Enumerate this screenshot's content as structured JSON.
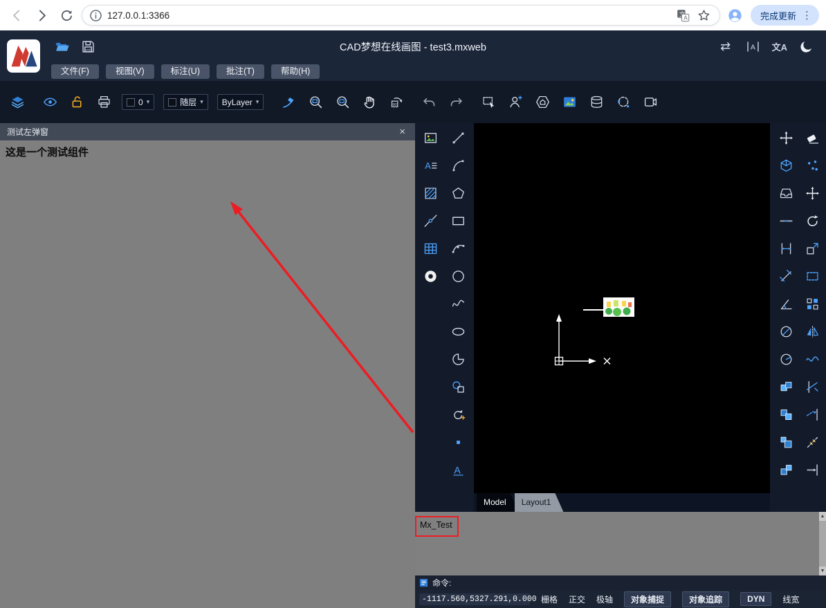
{
  "browser": {
    "url": "127.0.0.1:3366",
    "update_button_label": "完成更新"
  },
  "header": {
    "title": "CAD梦想在线画图 - test3.mxweb",
    "lang_button": "文A",
    "menus": [
      {
        "label": "文件(F)"
      },
      {
        "label": "视图(V)"
      },
      {
        "label": "标注(U)"
      },
      {
        "label": "批注(T)"
      },
      {
        "label": "帮助(H)"
      }
    ]
  },
  "ribbon": {
    "layer_value": "0",
    "color_value": "随层",
    "linetype_value": "ByLayer"
  },
  "left_panel": {
    "title": "测试左弹窗",
    "close_label": "×",
    "content": "这是一个测试组件"
  },
  "draw_tools": {
    "left_column": [
      "insert-image",
      "text-style",
      "hatch",
      "construction-line",
      "table",
      "donut"
    ],
    "right_column": [
      "line",
      "arc",
      "polygon",
      "rectangle",
      "arc-point",
      "circle",
      "spline",
      "ellipse",
      "pie",
      "block",
      "rotate-block",
      "point",
      "text"
    ]
  },
  "edit_tools": {
    "left_column": [
      "move-ucs",
      "box-3d",
      "tray",
      "break",
      "dim-linear",
      "dim-aligned",
      "dim-angular",
      "dim-diameter",
      "dim-radius",
      "copy-a",
      "copy-b",
      "copy-c",
      "copy-d"
    ],
    "right_column": [
      "erase",
      "point-style",
      "move",
      "rotate",
      "scale",
      "stretch",
      "array",
      "mirror",
      "spline-edit",
      "trim",
      "extend",
      "measure",
      "align"
    ]
  },
  "tabs": [
    {
      "label": "Model",
      "active": true
    },
    {
      "label": "Layout1",
      "active": false
    }
  ],
  "command": {
    "history_line": "Mx_Test",
    "prompt": "命令:"
  },
  "status": {
    "coordinates": "-1117.560,5327.291,0.000",
    "toggles": [
      {
        "label": "栅格",
        "active": false
      },
      {
        "label": "正交",
        "active": false
      },
      {
        "label": "极轴",
        "active": false
      },
      {
        "label": "对象捕捉",
        "active": true
      },
      {
        "label": "对象追踪",
        "active": true
      },
      {
        "label": "DYN",
        "active": true
      },
      {
        "label": "线宽",
        "active": false
      }
    ]
  },
  "icons": {
    "kebab": "⋮",
    "caret": "▾",
    "swap": "⇄",
    "scroll_up": "▲",
    "scroll_down": "▼"
  },
  "colors": {
    "accent_blue": "#4da3ff",
    "header_bg": "#1c2639",
    "toolbar_bg": "#111927",
    "panel_gray": "#7f7f7f",
    "annotation_red": "#ec1c24",
    "update_pill": "#d3e3fd"
  }
}
